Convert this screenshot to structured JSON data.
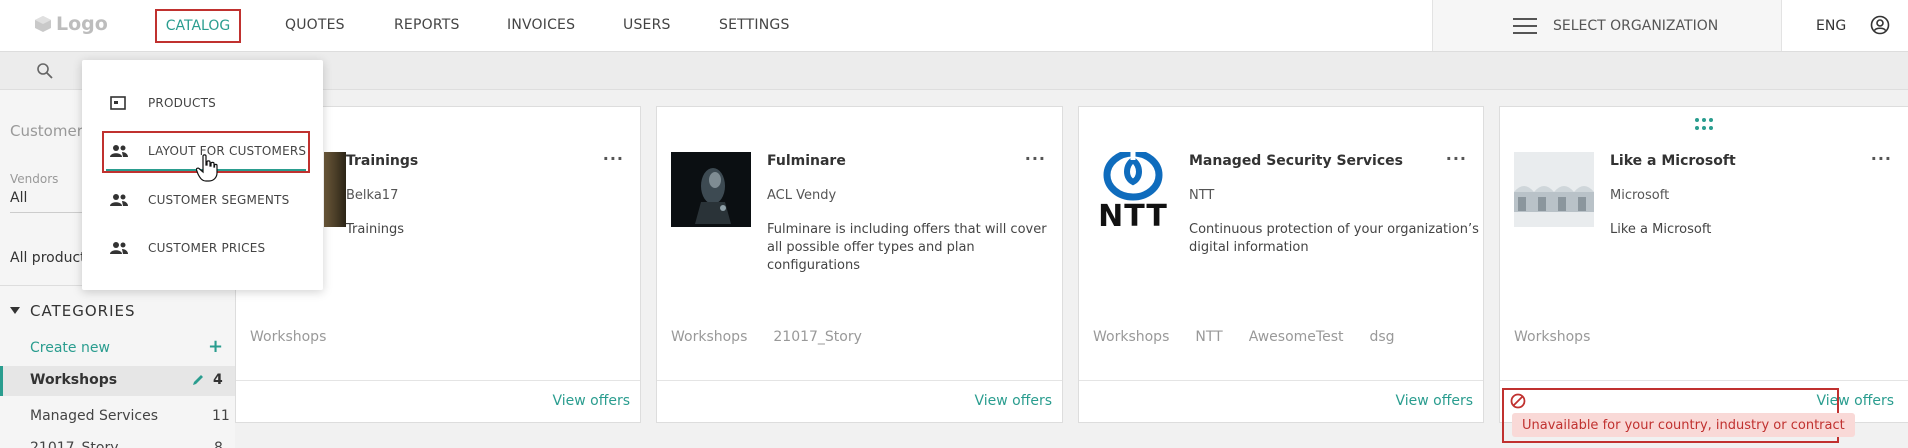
{
  "header": {
    "logo_text": "Logo",
    "nav": [
      "CATALOG",
      "QUOTES",
      "REPORTS",
      "INVOICES",
      "USERS",
      "SETTINGS"
    ],
    "org_label": "SELECT ORGANIZATION",
    "lang": "ENG"
  },
  "dropdown": {
    "items": [
      {
        "label": "PRODUCTS",
        "icon": "product-icon"
      },
      {
        "label": "LAYOUT FOR CUSTOMERS",
        "icon": "users-icon"
      },
      {
        "label": "CUSTOMER SEGMENTS",
        "icon": "users-icon"
      },
      {
        "label": "CUSTOMER PRICES",
        "icon": "users-icon"
      }
    ]
  },
  "sidebar": {
    "customer_placeholder": "Customer",
    "vendors_label": "Vendors",
    "vendors_value": "All",
    "all_products": "All product",
    "categories_title": "CATEGORIES",
    "create_new": "Create new",
    "active": {
      "name": "Workshops",
      "count": "4"
    },
    "rows": [
      {
        "name": "Managed Services",
        "count": "11"
      },
      {
        "name": "21017_Story",
        "count": "8"
      }
    ]
  },
  "cards": [
    {
      "title": "Trainings",
      "vendor": "Belka17",
      "desc": "Trainings",
      "tags": [
        "Workshops"
      ],
      "view": "View offers"
    },
    {
      "title": "Fulminare",
      "vendor": "ACL Vendy",
      "desc": "Fulminare is including offers that will cover all possible offer types and plan configurations",
      "tags": [
        "Workshops",
        "21017_Story"
      ],
      "view": "View offers"
    },
    {
      "title": "Managed Security Services",
      "vendor": "NTT",
      "desc": "Continuous protection of your organization’s digital information",
      "tags": [
        "Workshops",
        "NTT",
        "AwesomeTest",
        "dsg"
      ],
      "view": "View offers"
    },
    {
      "title": "Like a Microsoft",
      "vendor": "Microsoft",
      "desc": "Like a Microsoft",
      "tags": [
        "Workshops"
      ],
      "view": "View offers"
    }
  ],
  "unavailable_text": "Unavailable for your country, industry or contract",
  "ntt_logo_text": "NTT",
  "colors": {
    "accent": "#2a9d8f",
    "highlight": "#c0312f",
    "unavailable_bg": "#f9d9d7"
  }
}
